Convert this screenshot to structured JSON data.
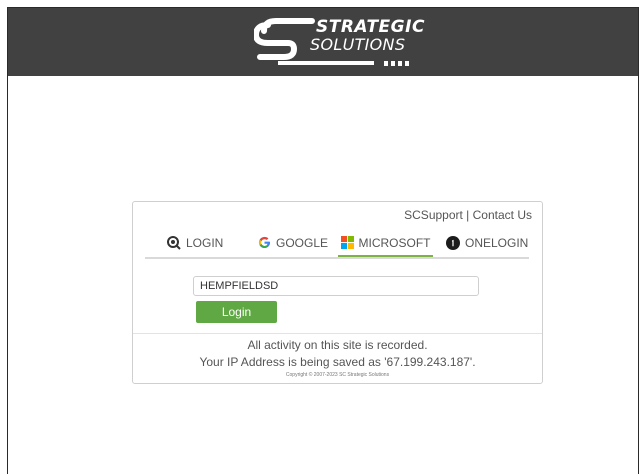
{
  "header": {
    "logo_line1": "STRATEGIC",
    "logo_line2": "SOLUTIONS",
    "background": "#414141"
  },
  "support": {
    "scsupport": "SCSupport",
    "separator": " | ",
    "contact": "Contact Us"
  },
  "tabs": [
    {
      "label": "LOGIN",
      "icon": "magnifier-key-icon",
      "active": false
    },
    {
      "label": "GOOGLE",
      "icon": "google-g-icon",
      "active": false
    },
    {
      "label": "MICROSOFT",
      "icon": "microsoft-logo-icon",
      "active": true
    },
    {
      "label": "ONELOGIN",
      "icon": "onelogin-icon",
      "active": false
    }
  ],
  "form": {
    "domain_value": "HEMPFIELDSD",
    "login_button": "Login"
  },
  "notice": {
    "line1": "All activity on this site is recorded.",
    "line2": "Your IP Address is being saved as '67.199.243.187'.",
    "copyright": "Copyright © 2007-2023 SC Strategic Solutions"
  },
  "colors": {
    "accent_green": "#5fa843",
    "active_tab_underline": "#7cb342"
  }
}
